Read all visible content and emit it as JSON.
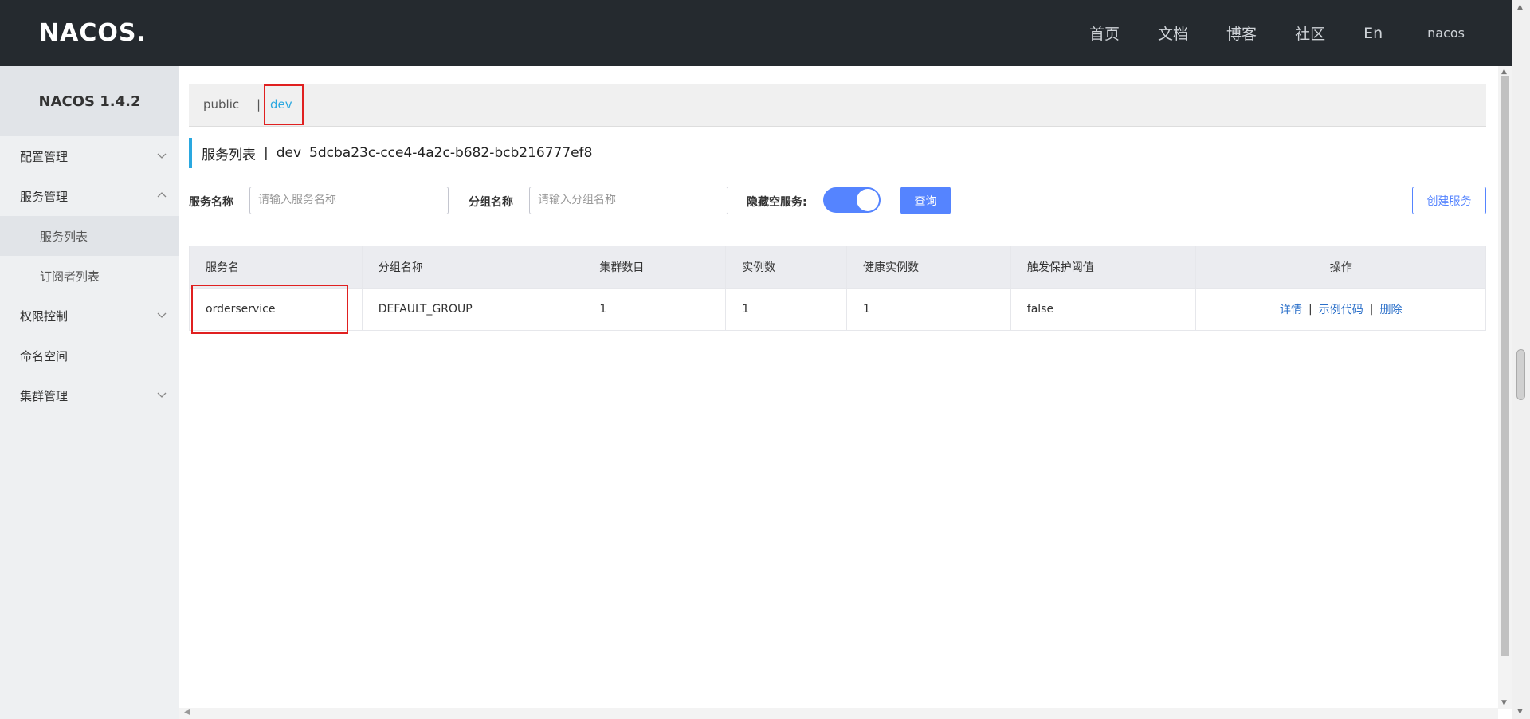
{
  "header": {
    "logo": "NACOS.",
    "nav": [
      "首页",
      "文档",
      "博客",
      "社区"
    ],
    "lang": "En",
    "user": "nacos"
  },
  "sidebar": {
    "title": "NACOS 1.4.2",
    "items": [
      {
        "label": "配置管理"
      },
      {
        "label": "服务管理"
      },
      {
        "label": "服务列表"
      },
      {
        "label": "订阅者列表"
      },
      {
        "label": "权限控制"
      },
      {
        "label": "命名空间"
      },
      {
        "label": "集群管理"
      }
    ]
  },
  "namespaces": {
    "public": "public",
    "separator": "|",
    "dev": "dev",
    "selected": "dev"
  },
  "page": {
    "title": "服务列表",
    "sep": "|",
    "ns_name": "dev",
    "ns_id": "5dcba23c-cce4-4a2c-b682-bcb216777ef8"
  },
  "filters": {
    "service_label": "服务名称",
    "service_placeholder": "请输入服务名称",
    "group_label": "分组名称",
    "group_placeholder": "请输入分组名称",
    "hide_empty_label": "隐藏空服务:",
    "hide_empty_on": true,
    "query_button": "查询",
    "create_button": "创建服务"
  },
  "table": {
    "headers": [
      "服务名",
      "分组名称",
      "集群数目",
      "实例数",
      "健康实例数",
      "触发保护阈值",
      "操作"
    ],
    "rows": [
      {
        "name": "orderservice",
        "group": "DEFAULT_GROUP",
        "clusters": "1",
        "instances": "1",
        "healthy": "1",
        "threshold": "false",
        "ops": [
          "详情",
          "示例代码",
          "删除"
        ]
      }
    ],
    "op_sep": "|"
  },
  "colors": {
    "header_bg": "#252a2f",
    "accent": "#5584ff",
    "link": "#2a6fc9",
    "highlight_box": "#e02020"
  }
}
